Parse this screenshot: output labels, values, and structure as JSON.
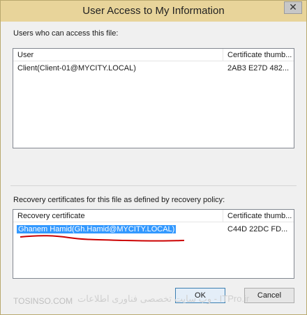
{
  "window": {
    "title": "User Access to My Information",
    "close_glyph": "✕"
  },
  "users_section": {
    "label": "Users who can access this file:",
    "columns": [
      "User",
      "Certificate thumb..."
    ],
    "rows": [
      {
        "user": "Client(Client-01@MYCITY.LOCAL)",
        "thumb": "2AB3 E27D 482..."
      }
    ]
  },
  "recovery_section": {
    "label": "Recovery certificates for this file as defined by recovery policy:",
    "columns": [
      "Recovery certificate",
      "Certificate thumb..."
    ],
    "rows": [
      {
        "cert": "Ghanem Hamid(Gh.Hamid@MYCITY.LOCAL)",
        "thumb": "C44D 22DC FD..."
      }
    ]
  },
  "buttons": {
    "ok": "OK",
    "cancel": "Cancel"
  },
  "watermark": {
    "left": "TOSINSO.COM",
    "right": "وب سایت تخصصی فناوری اطلاعات - ITPro.ir"
  },
  "colors": {
    "titlebar": "#e8d49a",
    "selection": "#3399ff",
    "annotation": "#cc0000"
  }
}
